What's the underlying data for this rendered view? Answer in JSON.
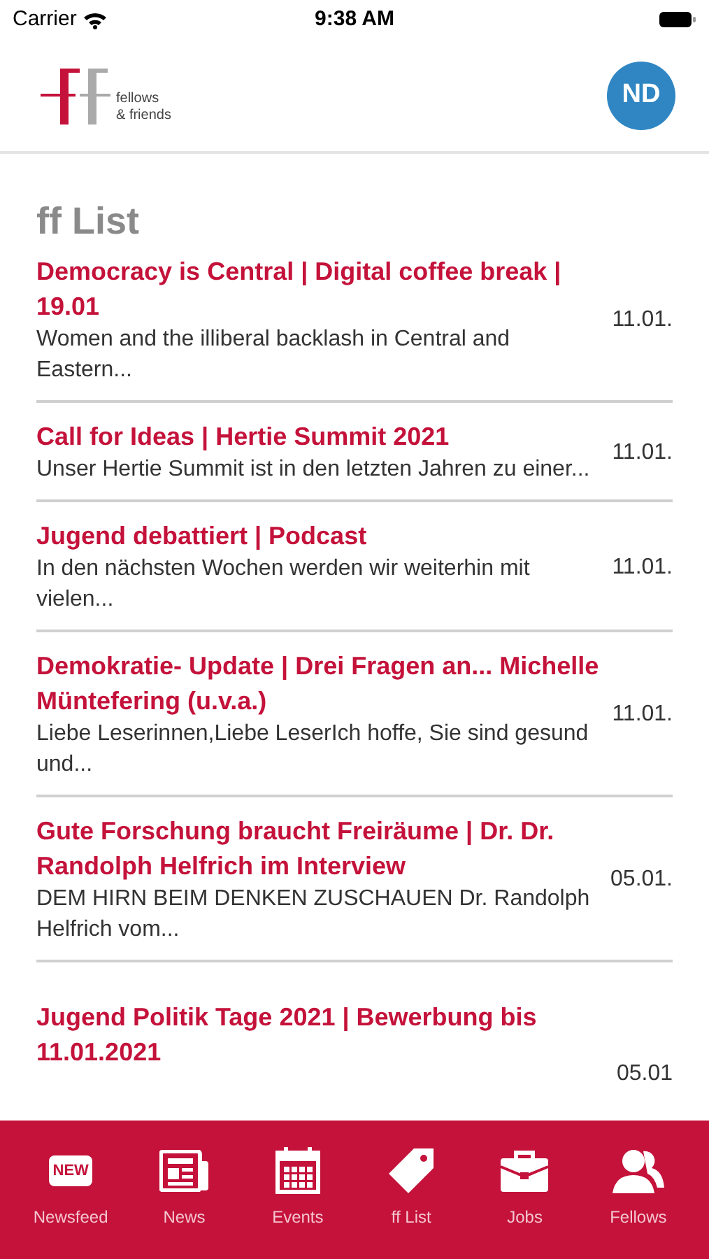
{
  "status_bar": {
    "carrier": "Carrier",
    "time": "9:38 AM"
  },
  "header": {
    "logo_line_1": "fellows",
    "logo_line_2": "& friends",
    "avatar": "ND"
  },
  "title": "ff List",
  "items": [
    {
      "title": "Democracy is Central | Digital coffee break | 19.01",
      "excerpt": "Women and the illiberal backlash in Central and Eastern...",
      "date": "11.01."
    },
    {
      "title": "Call for Ideas | Hertie Summit 2021",
      "excerpt": "Unser Hertie Summit ist in den letzten Jahren zu einer...",
      "date": "11.01."
    },
    {
      "title": "Jugend debattiert | Podcast",
      "excerpt": "In den nächsten Wochen werden wir weiterhin mit vielen...",
      "date": "11.01."
    },
    {
      "title": "Demokratie- Update | Drei Fragen an... Michelle Müntefering (u.v.a.)",
      "excerpt": "Liebe Leserinnen,Liebe LeserIch hoffe, Sie sind gesund und...",
      "date": "11.01."
    },
    {
      "title": "Gute Forschung braucht Freiräume | Dr. Dr. Randolph Helfrich im Interview",
      "excerpt": "DEM HIRN BEIM DENKEN ZUSCHAUEN Dr. Randolph Helfrich vom...",
      "date": "05.01."
    },
    {
      "title": "Jugend Politik Tage 2021 | Bewerbung bis 11.01.2021",
      "date": "05.01"
    }
  ],
  "tab_bar": [
    {
      "label": "Newsfeed",
      "kind": "new",
      "icon_text": "NEW"
    },
    {
      "label": "News",
      "kind": "news"
    },
    {
      "label": "Events",
      "kind": "events"
    },
    {
      "label": "ff List",
      "kind": "tag"
    },
    {
      "label": "Jobs",
      "kind": "jobs"
    },
    {
      "label": "Fellows",
      "kind": "fellows"
    }
  ]
}
